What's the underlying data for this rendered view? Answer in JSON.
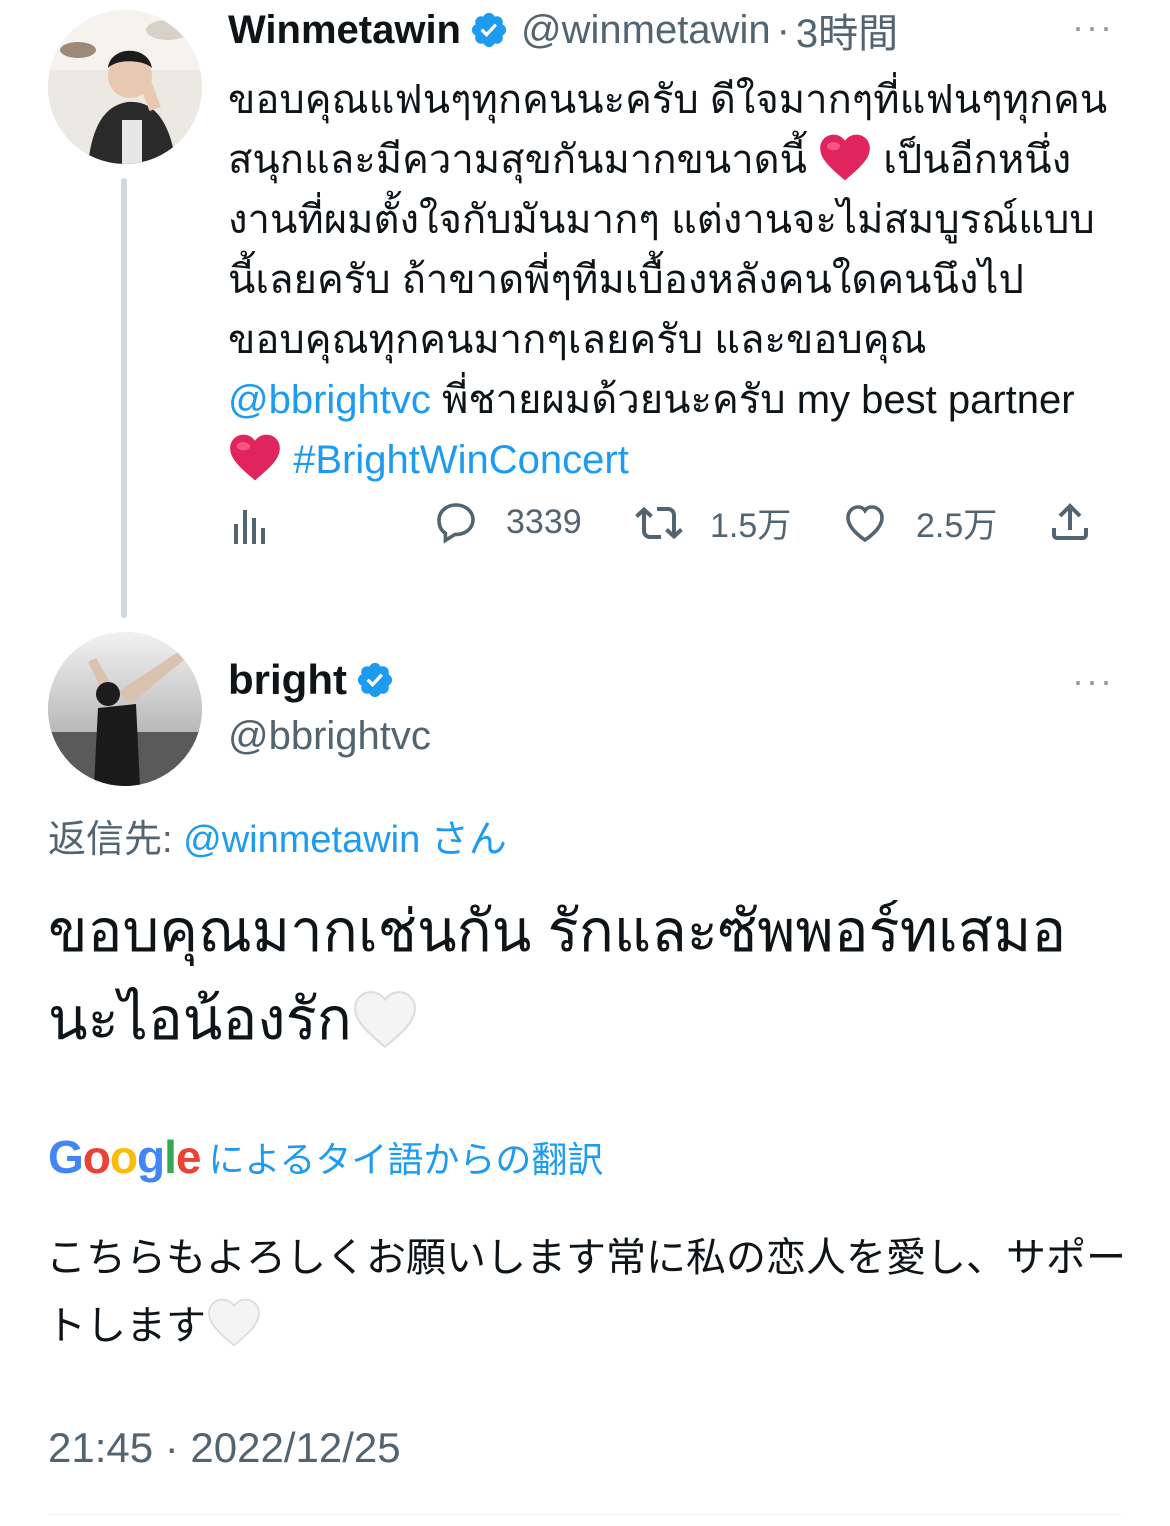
{
  "tweet1": {
    "name": "Winmetawin",
    "handle": "@winmetawin",
    "separator": "·",
    "time": "3時間",
    "more": "···",
    "text_part1": "ขอบคุณแฟนๆทุกคนนะครับ ดีใจมากๆที่แฟนๆทุกคนสนุกและมีความสุขกันมากขนาดนี้ ",
    "emoji_heart_1": "❤️",
    "text_part2": " เป็นอีกหนึ่งงานที่ผมตั้งใจกับมันมากๆ แต่งานจะไม่สมบูรณ์แบบนี้เลยครับ ถ้าขาดพี่ๆทีมเบื้องหลังคนใดคนนึงไป ขอบคุณทุกคนมากๆเลยครับ และขอบคุณ ",
    "mention": "@bbrightvc",
    "text_part3": " พี่ชายผมด้วยนะครับ my best partner ",
    "emoji_heart_2": "❤️",
    "hashtag": "#BrightWinConcert",
    "stats": {
      "replies": "3339",
      "retweets": "1.5万",
      "likes": "2.5万"
    }
  },
  "tweet2": {
    "name": "bright",
    "handle": "@bbrightvc",
    "more": "···",
    "reply_prefix": "返信先: ",
    "reply_handle": "@winmetawin",
    "reply_suffix": " さん",
    "text": "ขอบคุณมากเช่นกัน รักและซัพพอร์ทเสมอนะไอน้องรัก",
    "emoji_heart": "🤍",
    "translate_label": "によるタイ語からの翻訳",
    "translation": "こちらもよろしくお願いします常に私の恋人を愛し、サポートします",
    "translation_emoji": "🤍",
    "timestamp": "21:45 · 2022/12/25"
  },
  "google_logo": [
    "G",
    "o",
    "o",
    "g",
    "l",
    "e"
  ],
  "colors": {
    "link": "#1d9bf0",
    "secondary_text": "#536471",
    "thread_line": "#cfd9de",
    "red_heart": "#e0245e"
  }
}
